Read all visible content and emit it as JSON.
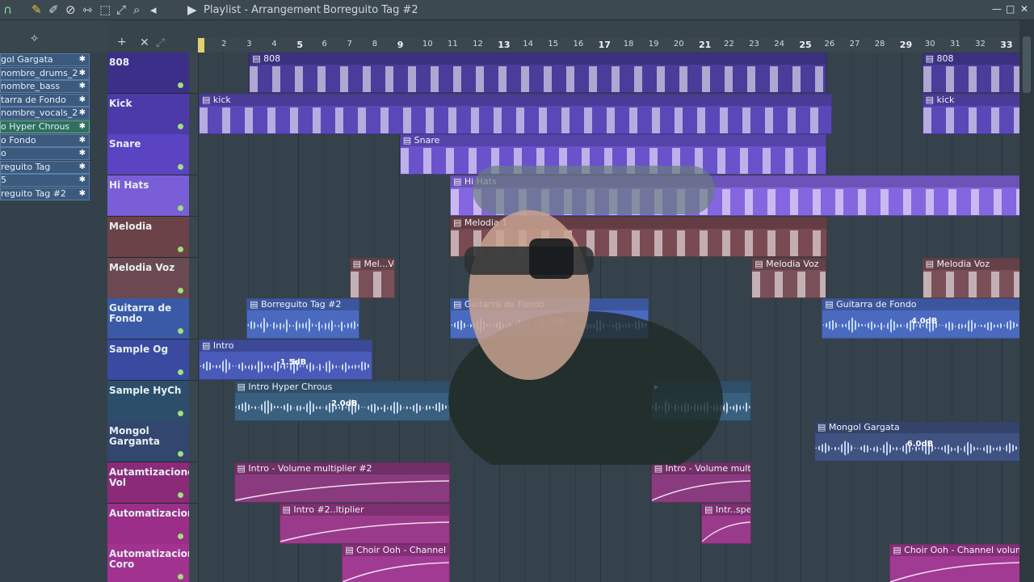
{
  "window": {
    "title": "Playlist - Arrangement",
    "pattern": "Borreguito Tag #2",
    "arrow": "▶",
    "min": "—",
    "max": "□",
    "close": "✕"
  },
  "toolbar_icons": [
    "magnet-icon",
    "pencil-icon",
    "paint-icon",
    "delete-icon",
    "mute-icon",
    "slip-icon",
    "select-icon",
    "zoom-icon",
    "playback-icon"
  ],
  "toolbar_glyphs": [
    "∩",
    "✎",
    "✐",
    "⊘",
    "⇿",
    "⬚",
    "⤢",
    "⌕",
    "◂"
  ],
  "browser": {
    "picker_items": [
      {
        "label": "gol Gargata",
        "star": "✱",
        "sel": false
      },
      {
        "label": "nombre_drums_2",
        "star": "✱",
        "sel": false
      },
      {
        "label": "nombre_bass",
        "star": "✱",
        "sel": false
      },
      {
        "label": "tarra de Fondo",
        "star": "✱",
        "sel": false
      },
      {
        "label": "nombre_vocals_2",
        "star": "✱",
        "sel": false
      },
      {
        "label": "o Hyper Chrous",
        "star": "✱",
        "sel": true
      },
      {
        "label": "o Fondo",
        "star": "✱",
        "sel": false
      },
      {
        "label": "o",
        "star": "✱",
        "sel": false
      },
      {
        "label": "reguito Tag",
        "star": "✱",
        "sel": false
      },
      {
        "label": "5",
        "star": "✱",
        "sel": false
      },
      {
        "label": "reguito Tag #2",
        "star": "✱",
        "sel": false
      }
    ]
  },
  "ruler": {
    "numbers": [
      "2",
      "3",
      "4",
      "5",
      "6",
      "7",
      "8",
      "9",
      "10",
      "11",
      "12",
      "13",
      "14",
      "15",
      "16",
      "17",
      "18",
      "19",
      "20",
      "21",
      "22",
      "23",
      "24",
      "25",
      "26",
      "27",
      "28",
      "29",
      "30",
      "31",
      "32",
      "33"
    ],
    "bold": [
      "5",
      "9",
      "13",
      "17",
      "21",
      "25",
      "29",
      "33"
    ]
  },
  "tracks": [
    {
      "name": "808",
      "color": "#3b2f8a"
    },
    {
      "name": "Kick",
      "color": "#4b3aa8"
    },
    {
      "name": "Snare",
      "color": "#5a44c2"
    },
    {
      "name": "Hi Hats",
      "color": "#7a5ed8"
    },
    {
      "name": "Melodia",
      "color": "#6a4248"
    },
    {
      "name": "Melodia Voz",
      "color": "#6a4a50"
    },
    {
      "name": "Guitarra de Fondo",
      "color": "#3a5aa8"
    },
    {
      "name": "Sample Og",
      "color": "#3a4aa0"
    },
    {
      "name": "Sample HyCh",
      "color": "#2c4e6a"
    },
    {
      "name": "Mongol Garganta",
      "color": "#33466e"
    },
    {
      "name": "Autamtizaciones Vol",
      "color": "#8a2a78"
    },
    {
      "name": "Automatizaciones",
      "color": "#9a2e88"
    },
    {
      "name": "Automatizaciones Coro",
      "color": "#a23290"
    }
  ],
  "clips": [
    {
      "t": 0,
      "b": [
        {
          "s": 3,
          "e": 26,
          "label": "808"
        },
        {
          "s": 29.8,
          "e": 34,
          "label": "808"
        }
      ],
      "type": "notes",
      "col": "#4a3c9a"
    },
    {
      "t": 1,
      "b": [
        {
          "s": 1,
          "e": 26.2,
          "label": "kick"
        },
        {
          "s": 29.8,
          "e": 34,
          "label": "kick"
        }
      ],
      "type": "notes",
      "col": "#5b48b8"
    },
    {
      "t": 2,
      "b": [
        {
          "s": 9,
          "e": 26,
          "label": "Snare"
        }
      ],
      "type": "notes",
      "col": "#6a52cc"
    },
    {
      "t": 3,
      "b": [
        {
          "s": 11,
          "e": 34,
          "label": "Hi Hats"
        }
      ],
      "type": "notes",
      "col": "#8466e0"
    },
    {
      "t": 4,
      "b": [
        {
          "s": 11,
          "e": 26,
          "label": "Melodia 1"
        }
      ],
      "type": "notes",
      "col": "#7a4a52"
    },
    {
      "t": 5,
      "b": [
        {
          "s": 7,
          "e": 8.8,
          "label": "Mel...Voz"
        },
        {
          "s": 23,
          "e": 26,
          "label": "Melodia Voz"
        },
        {
          "s": 29.8,
          "e": 34,
          "label": "Melodia Voz"
        }
      ],
      "type": "notes",
      "col": "#7a5058"
    },
    {
      "t": 6,
      "b": [
        {
          "s": 2.9,
          "e": 7.4,
          "label": "Borreguito Tag #2"
        },
        {
          "s": 11,
          "e": 18.9,
          "label": "Guitarra de Fondo",
          "db": "2.0dB"
        },
        {
          "s": 25.8,
          "e": 34,
          "label": "Guitarra de Fondo",
          "db": "4.0dB"
        }
      ],
      "type": "wave",
      "col": "#4a6ac0"
    },
    {
      "t": 7,
      "b": [
        {
          "s": 1,
          "e": 7.9,
          "label": "Intro",
          "db": "-1.5dB"
        }
      ],
      "type": "wave",
      "col": "#4a5ab8"
    },
    {
      "t": 8,
      "b": [
        {
          "s": 2.4,
          "e": 11,
          "label": "Intro Hyper Chrous",
          "db": "2.0dB"
        },
        {
          "s": 19,
          "e": 23,
          "label": ""
        }
      ],
      "type": "wave",
      "col": "#3a6080"
    },
    {
      "t": 9,
      "b": [
        {
          "s": 25.5,
          "e": 34,
          "label": "Mongol Gargata",
          "db": "6.0dB"
        }
      ],
      "type": "wave",
      "col": "#3f5282"
    },
    {
      "t": 10,
      "b": [
        {
          "s": 2.4,
          "e": 11,
          "label": "Intro - Volume multiplier #2"
        },
        {
          "s": 19,
          "e": 23,
          "label": "Intro - Volume multiplier"
        }
      ],
      "type": "auto",
      "col": "#8a3a7e"
    },
    {
      "t": 11,
      "b": [
        {
          "s": 4.2,
          "e": 11,
          "label": "Intro #2..ltiplier"
        },
        {
          "s": 21,
          "e": 23,
          "label": "Intr..speed"
        }
      ],
      "type": "auto",
      "col": "#9a3a8a"
    },
    {
      "t": 12,
      "b": [
        {
          "s": 6.7,
          "e": 11,
          "label": "Choir Ooh - Channel volume"
        },
        {
          "s": 28.5,
          "e": 34,
          "label": "Choir Ooh - Channel volume"
        }
      ],
      "type": "auto",
      "col": "#a03a92"
    }
  ]
}
